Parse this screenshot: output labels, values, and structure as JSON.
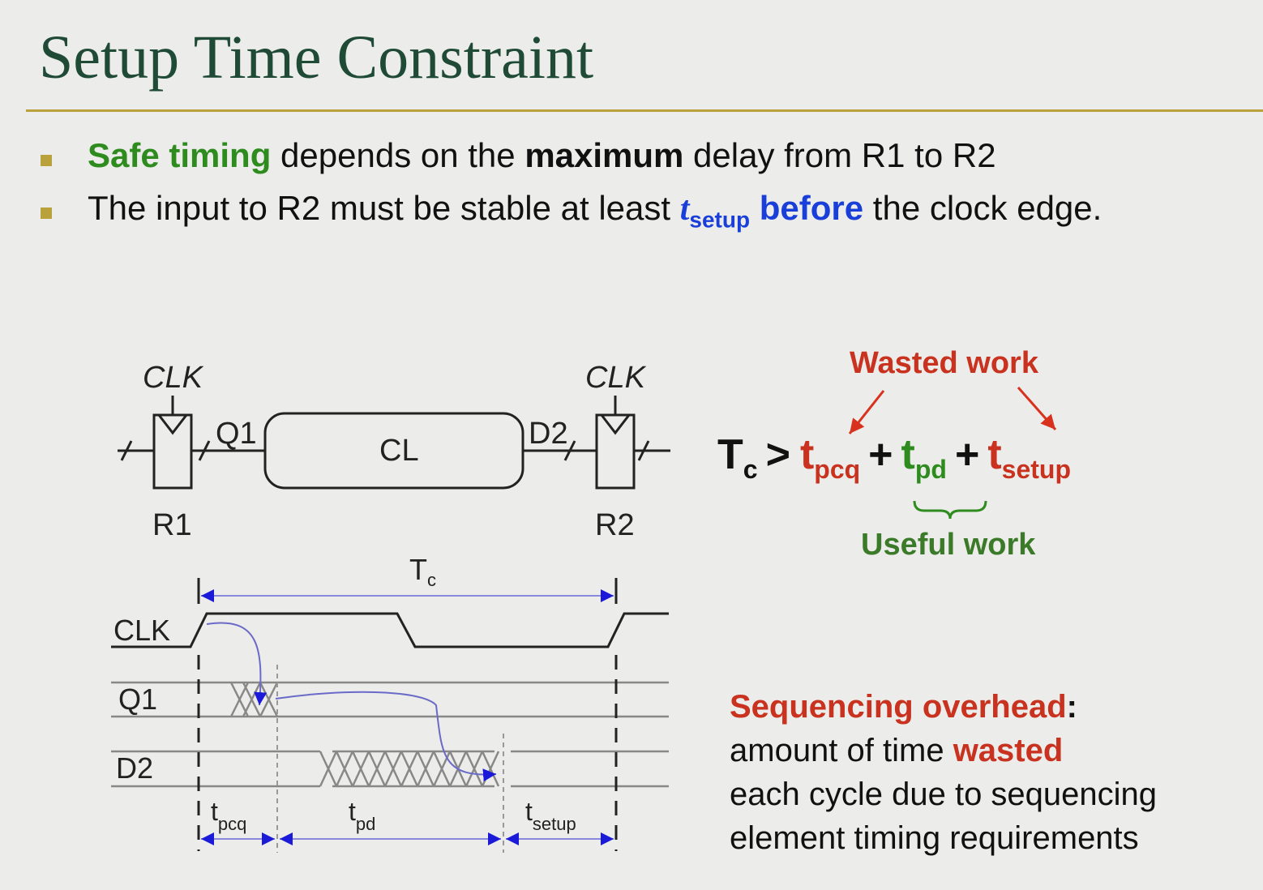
{
  "title": "Setup Time Constraint",
  "bullets": [
    {
      "parts": [
        "Safe timing",
        " depends on the ",
        "maximum",
        " delay from R1 to R2"
      ]
    },
    {
      "parts": [
        "The input to R2 must be stable at least ",
        "t",
        "setup",
        " before",
        " the clock edge."
      ]
    }
  ],
  "circuit": {
    "clk_left": "CLK",
    "clk_right": "CLK",
    "q1": "Q1",
    "d2": "D2",
    "cl": "CL",
    "r1": "R1",
    "r2": "R2"
  },
  "equation": {
    "lhs": "T",
    "lhs_sub": "c",
    "gt": ">",
    "t1": "t",
    "t1_sub": "pcq",
    "plus1": "+",
    "t2": "t",
    "t2_sub": "pd",
    "plus2": "+",
    "t3": "t",
    "t3_sub": "setup",
    "wasted_label": "Wasted work",
    "useful_label": "Useful work"
  },
  "timing": {
    "tc": "T",
    "tc_sub": "c",
    "signals": [
      "CLK",
      "Q1",
      "D2"
    ],
    "tpcq": "t",
    "tpcq_sub": "pcq",
    "tpd": "t",
    "tpd_sub": "pd",
    "tsetup": "t",
    "tsetup_sub": "setup"
  },
  "overhead": {
    "heading": "Sequencing overhead",
    "colon": ":",
    "line1a": "amount of time ",
    "line1b": "wasted",
    "line2": "each cycle due to sequencing",
    "line3": "element timing requirements"
  },
  "colors": {
    "title": "#1f4a36",
    "green": "#2e8b1e",
    "blue": "#1a3fd8",
    "red": "#c8321e",
    "arrow": "#1a1ad8"
  }
}
